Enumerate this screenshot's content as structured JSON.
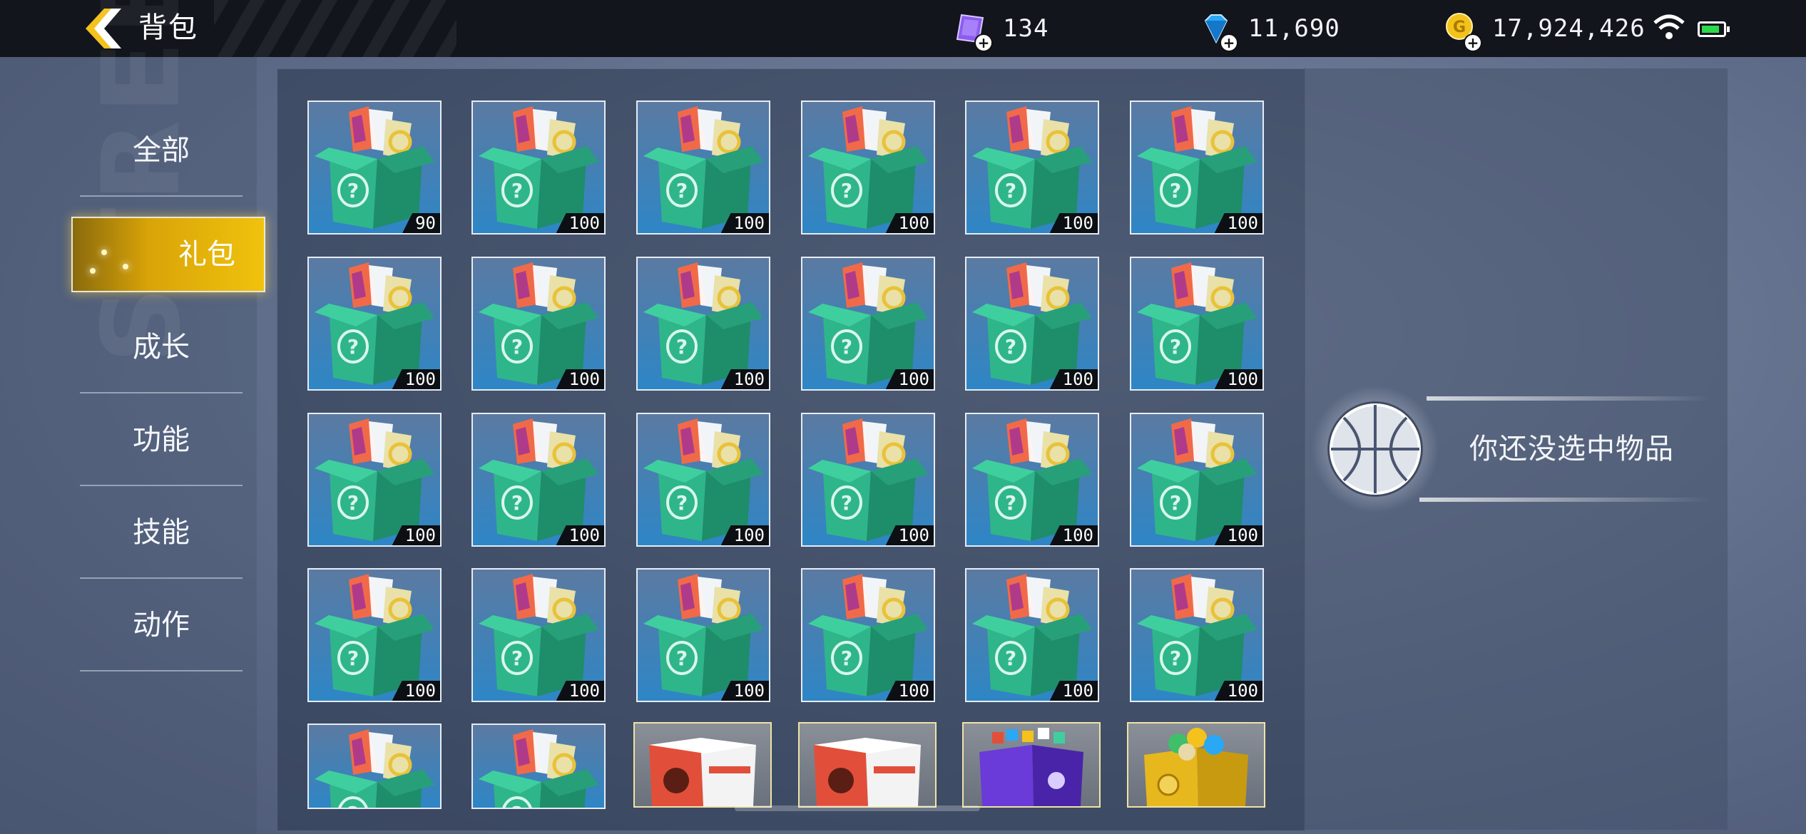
{
  "header": {
    "title": "背包",
    "currencies": [
      {
        "name": "ticket-icon",
        "value": "134",
        "color": "#8c5cf0"
      },
      {
        "name": "diamond-icon",
        "value": "11,690",
        "color": "#2aa8f5"
      },
      {
        "name": "gold-coin-icon",
        "value": "17,924,426",
        "color": "#f3c21c"
      }
    ],
    "battery_level": 0.85
  },
  "nav": {
    "items": [
      {
        "label": "全部"
      },
      {
        "label": "礼包"
      },
      {
        "label": "成长"
      },
      {
        "label": "功能"
      },
      {
        "label": "技能"
      },
      {
        "label": "动作"
      }
    ],
    "active_index": 1
  },
  "inventory": {
    "items": [
      {
        "kind": "mystery-box",
        "qty": "90"
      },
      {
        "kind": "mystery-box",
        "qty": "100"
      },
      {
        "kind": "mystery-box",
        "qty": "100"
      },
      {
        "kind": "mystery-box",
        "qty": "100"
      },
      {
        "kind": "mystery-box",
        "qty": "100"
      },
      {
        "kind": "mystery-box",
        "qty": "100"
      },
      {
        "kind": "mystery-box",
        "qty": "100"
      },
      {
        "kind": "mystery-box",
        "qty": "100"
      },
      {
        "kind": "mystery-box",
        "qty": "100"
      },
      {
        "kind": "mystery-box",
        "qty": "100"
      },
      {
        "kind": "mystery-box",
        "qty": "100"
      },
      {
        "kind": "mystery-box",
        "qty": "100"
      },
      {
        "kind": "mystery-box",
        "qty": "100"
      },
      {
        "kind": "mystery-box",
        "qty": "100"
      },
      {
        "kind": "mystery-box",
        "qty": "100"
      },
      {
        "kind": "mystery-box",
        "qty": "100"
      },
      {
        "kind": "mystery-box",
        "qty": "100"
      },
      {
        "kind": "mystery-box",
        "qty": "100"
      },
      {
        "kind": "mystery-box",
        "qty": "100"
      },
      {
        "kind": "mystery-box",
        "qty": "100"
      },
      {
        "kind": "mystery-box",
        "qty": "100"
      },
      {
        "kind": "mystery-box",
        "qty": "100"
      },
      {
        "kind": "mystery-box",
        "qty": "100"
      },
      {
        "kind": "mystery-box",
        "qty": "100"
      },
      {
        "kind": "mystery-box",
        "qty": ""
      },
      {
        "kind": "mystery-box",
        "qty": ""
      },
      {
        "kind": "red-gift-box",
        "qty": ""
      },
      {
        "kind": "red-gift-box",
        "qty": ""
      },
      {
        "kind": "purple-gift-box",
        "qty": ""
      },
      {
        "kind": "gold-gift-box",
        "qty": ""
      }
    ]
  },
  "detail": {
    "empty_message": "你还没选中物品"
  },
  "colors": {
    "accent_gold": "#f0c20d",
    "box_green": "#2fb58a",
    "slot_blue": "#2e86c6"
  }
}
